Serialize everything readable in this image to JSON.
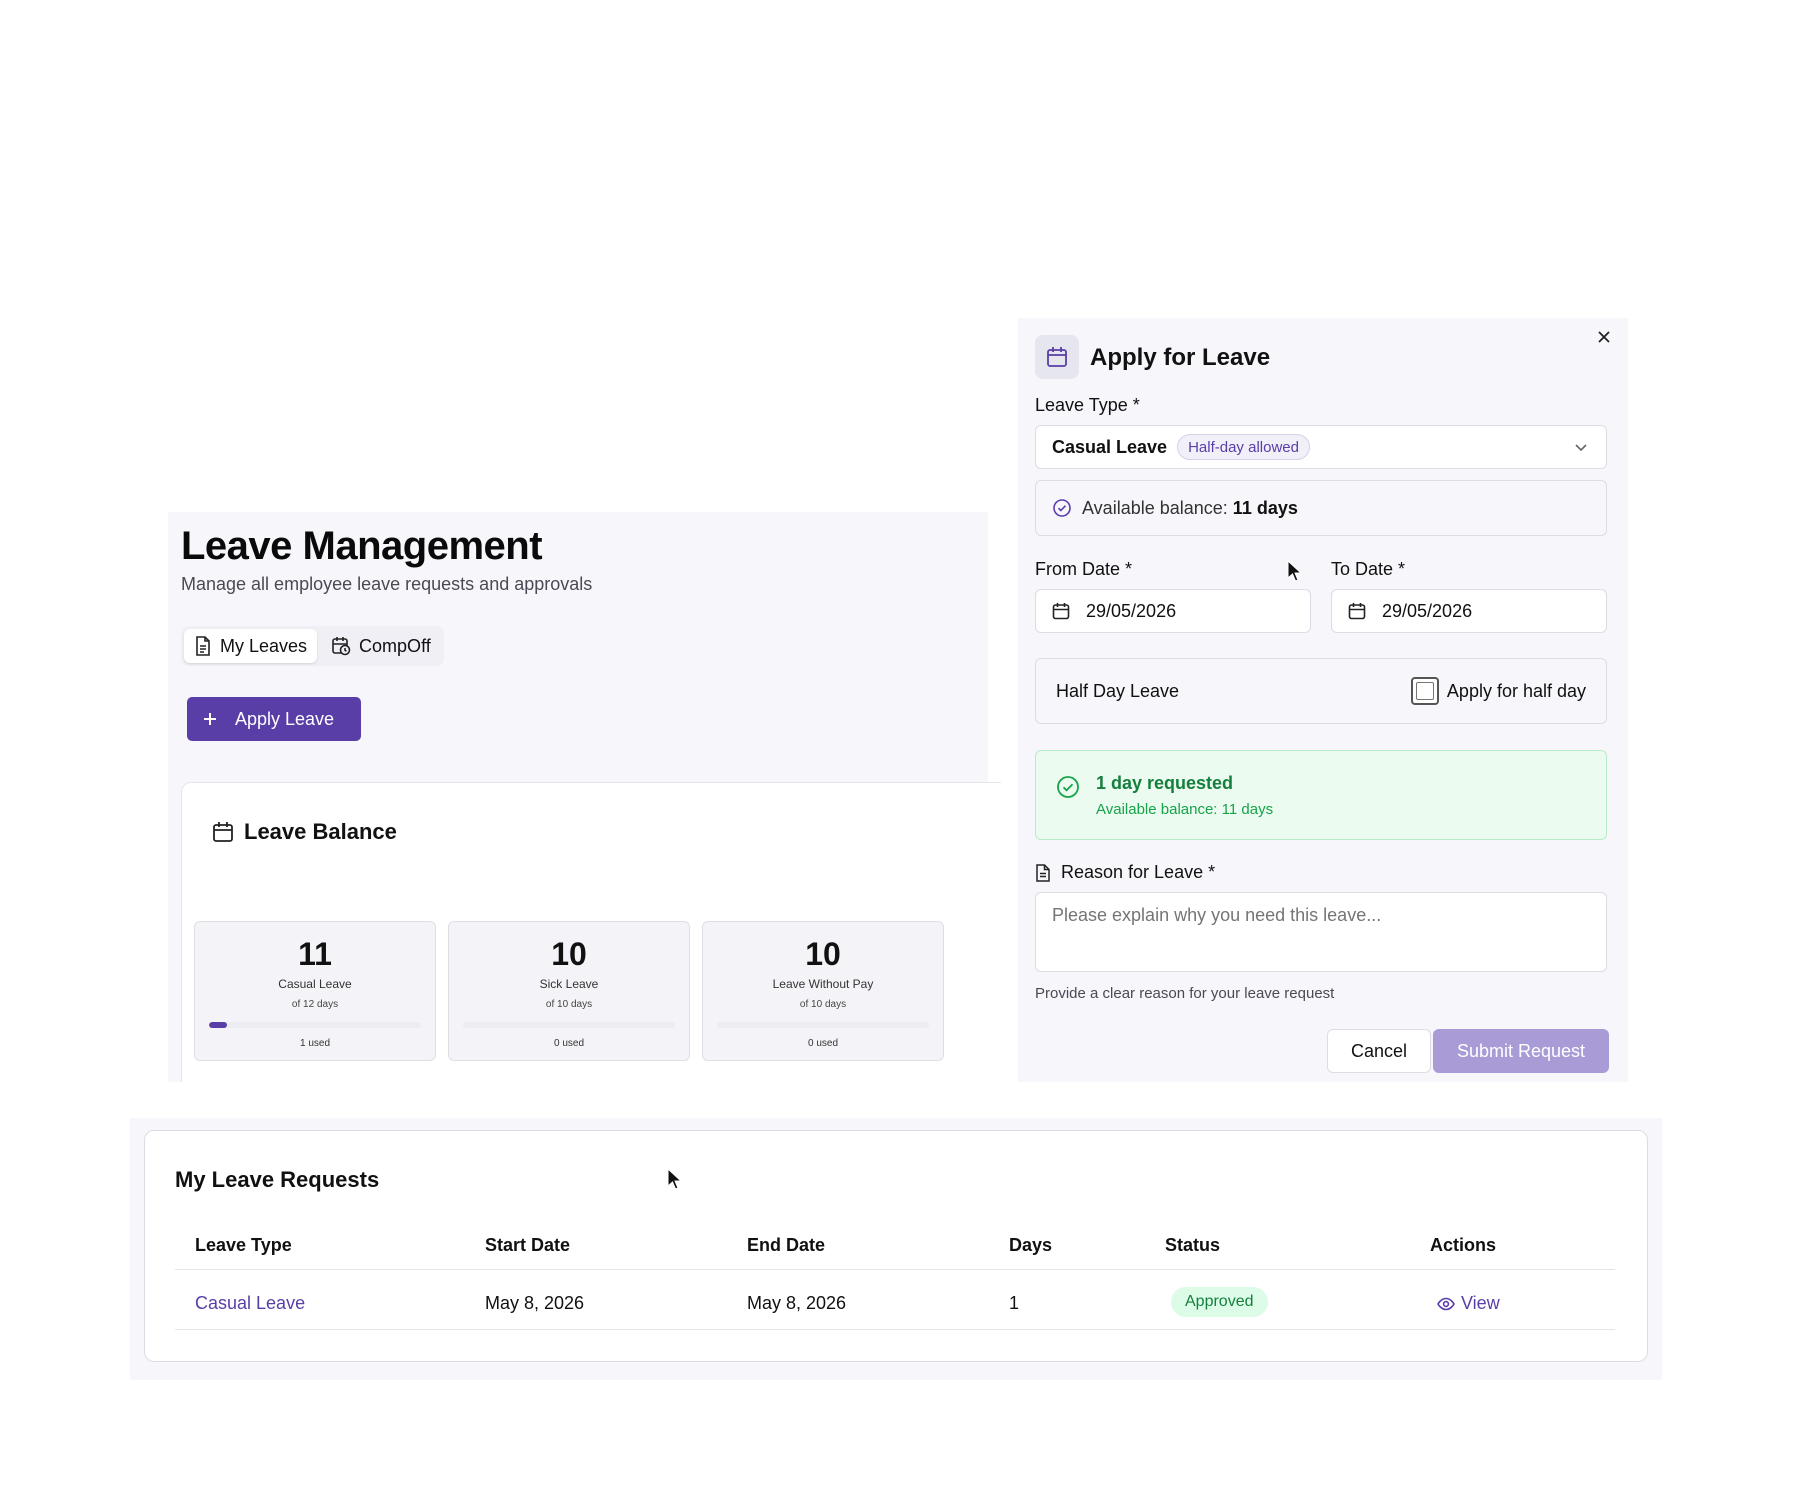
{
  "page": {
    "title": "Leave Management",
    "subtitle": "Manage all employee leave requests and approvals",
    "tabs": [
      {
        "label": "My Leaves",
        "icon": "document-icon",
        "active": true
      },
      {
        "label": "CompOff",
        "icon": "calendar-clock-icon",
        "active": false
      }
    ],
    "apply_button": "Apply Leave"
  },
  "balance": {
    "title": "Leave Balance",
    "accent": "#5a3ea8",
    "items": [
      {
        "count": "11",
        "label": "Casual Leave",
        "of": "of 12 days",
        "used": "1 used",
        "used_fraction": 0.0833
      },
      {
        "count": "10",
        "label": "Sick Leave",
        "of": "of 10 days",
        "used": "0 used",
        "used_fraction": 0
      },
      {
        "count": "10",
        "label": "Leave Without Pay",
        "of": "of 10 days",
        "used": "0 used",
        "used_fraction": 0
      }
    ]
  },
  "modal": {
    "title": "Apply for Leave",
    "leave_type_label": "Leave Type *",
    "leave_type_value": "Casual Leave",
    "leave_type_badge": "Half-day allowed",
    "available_prefix": "Available balance:",
    "available_value": "11 days",
    "from_label": "From Date *",
    "from_value": "29/05/2026",
    "to_label": "To Date *",
    "to_value": "29/05/2026",
    "half_day_label": "Half Day Leave",
    "half_day_checkbox": "Apply for half day",
    "half_day_checked": false,
    "summary_title": "1 day requested",
    "summary_sub": "Available balance: 11 days",
    "reason_label": "Reason for Leave *",
    "reason_placeholder": "Please explain why you need this leave...",
    "reason_hint": "Provide a clear reason for your leave request",
    "cancel": "Cancel",
    "submit": "Submit Request"
  },
  "requests": {
    "title": "My Leave Requests",
    "columns": [
      "Leave Type",
      "Start Date",
      "End Date",
      "Days",
      "Status",
      "Actions"
    ],
    "rows": [
      {
        "type": "Casual Leave",
        "start": "May 8, 2026",
        "end": "May 8, 2026",
        "days": "1",
        "status": "Approved",
        "action": "View"
      }
    ]
  }
}
